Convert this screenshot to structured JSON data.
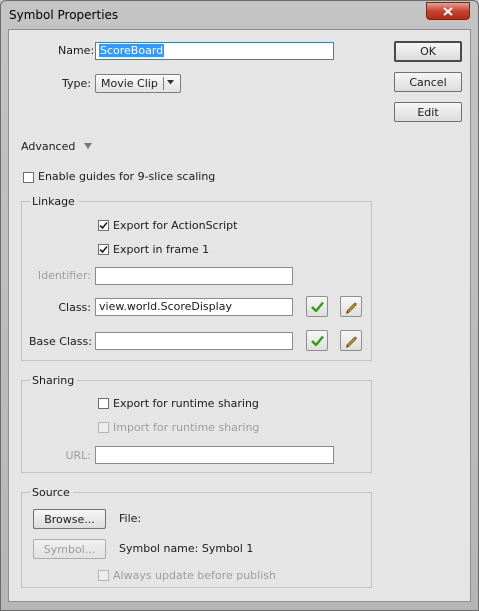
{
  "window": {
    "title": "Symbol Properties"
  },
  "properties": {
    "name_label": "Name:",
    "name_value": "ScoreBoard",
    "type_label": "Type:",
    "type_value": "Movie Clip"
  },
  "buttons": {
    "ok": "OK",
    "cancel": "Cancel",
    "edit": "Edit"
  },
  "advanced": {
    "label": "Advanced",
    "nine_slice": "Enable guides for 9-slice scaling"
  },
  "linkage": {
    "title": "Linkage",
    "export_actionscript": "Export for ActionScript",
    "export_frame1": "Export in frame 1",
    "identifier_label": "Identifier:",
    "identifier_value": "",
    "class_label": "Class:",
    "class_value": "view.world.ScoreDisplay",
    "base_class_label": "Base Class:",
    "base_class_value": ""
  },
  "sharing": {
    "title": "Sharing",
    "export_runtime": "Export for runtime sharing",
    "import_runtime": "Import for runtime sharing",
    "url_label": "URL:",
    "url_value": ""
  },
  "source": {
    "title": "Source",
    "browse": "Browse...",
    "file_label": "File:",
    "symbol_button": "Symbol...",
    "symbol_name": "Symbol name: Symbol 1",
    "always_update": "Always update before publish"
  },
  "colors": {
    "check_green": "#3a9a1c",
    "selection": "#3399ff",
    "close_red": "#c7432d"
  }
}
